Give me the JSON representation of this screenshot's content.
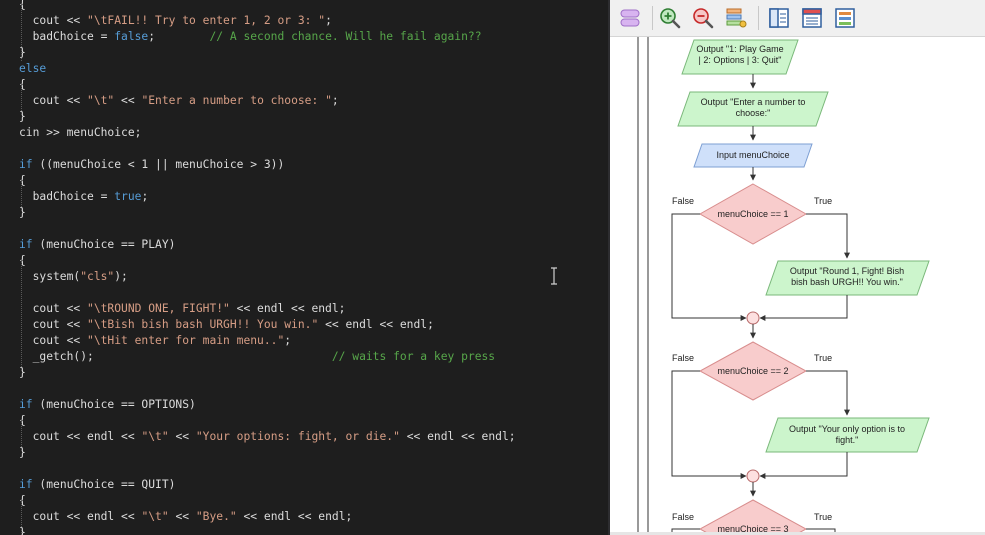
{
  "editor": {
    "lines": [
      [
        {
          "t": "{",
          "c": "plain"
        }
      ],
      [
        {
          "t": "  cout << ",
          "c": "plain"
        },
        {
          "t": "\"\\tFAIL!! Try to enter 1, 2 or 3: \"",
          "c": "str"
        },
        {
          "t": ";",
          "c": "plain"
        }
      ],
      [
        {
          "t": "  badChoice = ",
          "c": "plain"
        },
        {
          "t": "false",
          "c": "kw"
        },
        {
          "t": ";        ",
          "c": "plain"
        },
        {
          "t": "// A second chance. Will he fail again??",
          "c": "cmt"
        }
      ],
      [
        {
          "t": "}",
          "c": "plain"
        }
      ],
      [
        {
          "t": "else",
          "c": "kw"
        }
      ],
      [
        {
          "t": "{",
          "c": "plain"
        }
      ],
      [
        {
          "t": "  cout << ",
          "c": "plain"
        },
        {
          "t": "\"\\t\"",
          "c": "str"
        },
        {
          "t": " << ",
          "c": "plain"
        },
        {
          "t": "\"Enter a number to choose: \"",
          "c": "str"
        },
        {
          "t": ";",
          "c": "plain"
        }
      ],
      [
        {
          "t": "}",
          "c": "plain"
        }
      ],
      [
        {
          "t": "cin >> menuChoice;",
          "c": "plain"
        }
      ],
      [],
      [
        {
          "t": "if",
          "c": "kw"
        },
        {
          "t": " ((menuChoice < 1 || menuChoice > 3))",
          "c": "plain"
        }
      ],
      [
        {
          "t": "{",
          "c": "plain"
        }
      ],
      [
        {
          "t": "  badChoice = ",
          "c": "plain"
        },
        {
          "t": "true",
          "c": "kw"
        },
        {
          "t": ";",
          "c": "plain"
        }
      ],
      [
        {
          "t": "}",
          "c": "plain"
        }
      ],
      [],
      [
        {
          "t": "if",
          "c": "kw"
        },
        {
          "t": " (menuChoice == PLAY)",
          "c": "plain"
        }
      ],
      [
        {
          "t": "{",
          "c": "plain"
        }
      ],
      [
        {
          "t": "  system(",
          "c": "plain"
        },
        {
          "t": "\"cls\"",
          "c": "str"
        },
        {
          "t": ");",
          "c": "plain"
        }
      ],
      [],
      [
        {
          "t": "  cout << ",
          "c": "plain"
        },
        {
          "t": "\"\\tROUND ONE, FIGHT!\"",
          "c": "str"
        },
        {
          "t": " << endl << endl;",
          "c": "plain"
        }
      ],
      [
        {
          "t": "  cout << ",
          "c": "plain"
        },
        {
          "t": "\"\\tBish bish bash URGH!! You win.\"",
          "c": "str"
        },
        {
          "t": " << endl << endl;",
          "c": "plain"
        }
      ],
      [
        {
          "t": "  cout << ",
          "c": "plain"
        },
        {
          "t": "\"\\tHit enter for main menu..\"",
          "c": "str"
        },
        {
          "t": ";",
          "c": "plain"
        }
      ],
      [
        {
          "t": "  _getch();                                   ",
          "c": "plain"
        },
        {
          "t": "// waits for a key press",
          "c": "cmt"
        }
      ],
      [
        {
          "t": "}",
          "c": "plain"
        }
      ],
      [],
      [
        {
          "t": "if",
          "c": "kw"
        },
        {
          "t": " (menuChoice == OPTIONS)",
          "c": "plain"
        }
      ],
      [
        {
          "t": "{",
          "c": "plain"
        }
      ],
      [
        {
          "t": "  cout << endl << ",
          "c": "plain"
        },
        {
          "t": "\"\\t\"",
          "c": "str"
        },
        {
          "t": " << ",
          "c": "plain"
        },
        {
          "t": "\"Your options: fight, or die.\"",
          "c": "str"
        },
        {
          "t": " << endl << endl;",
          "c": "plain"
        }
      ],
      [
        {
          "t": "}",
          "c": "plain"
        }
      ],
      [],
      [
        {
          "t": "if",
          "c": "kw"
        },
        {
          "t": " (menuChoice == QUIT)",
          "c": "plain"
        }
      ],
      [
        {
          "t": "{",
          "c": "plain"
        }
      ],
      [
        {
          "t": "  cout << endl << ",
          "c": "plain"
        },
        {
          "t": "\"\\t\"",
          "c": "str"
        },
        {
          "t": " << ",
          "c": "plain"
        },
        {
          "t": "\"Bye.\"",
          "c": "str"
        },
        {
          "t": " << endl << endl;",
          "c": "plain"
        }
      ],
      [
        {
          "t": "}",
          "c": "plain"
        }
      ]
    ]
  },
  "toolbar": {
    "buttons": [
      "shapes-icon",
      "zoom-in-icon",
      "zoom-out-icon",
      "layers-icon",
      "layout-split-icon",
      "layout-top-icon",
      "layout-list-icon"
    ]
  },
  "flowchart": {
    "output_menu": "Output \"1: Play Game | 2: Options | 3: Quit\"",
    "output_prompt": "Output \"Enter a number to choose:\"",
    "input": "Input menuChoice",
    "decision1": "menuChoice == 1",
    "output_round": "Output \"Round 1, Fight! Bish bish bash URGH!! You win.\"",
    "decision2": "menuChoice == 2",
    "output_options": "Output \"Your only option is to fight.\"",
    "decision3": "menuChoice == 3",
    "label_false": "False",
    "label_true": "True",
    "colors": {
      "io_fill": "#ccf5cc",
      "io_stroke": "#7ab87a",
      "input_fill": "#cfe0fa",
      "input_stroke": "#7d9fd3",
      "decision_fill": "#f8cccc",
      "decision_stroke": "#d88d8d"
    }
  }
}
